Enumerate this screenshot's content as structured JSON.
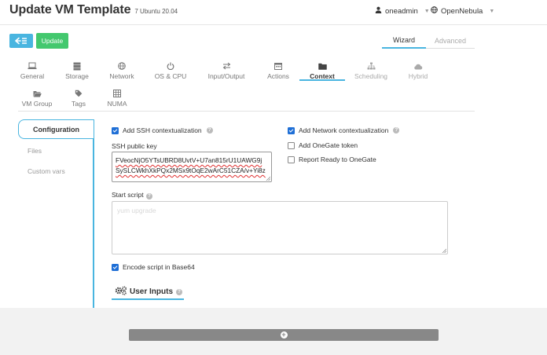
{
  "header": {
    "title": "Update VM Template",
    "subtitle": "7 Ubuntu 20.04",
    "user": "oneadmin",
    "zone": "OpenNebula"
  },
  "toolbar": {
    "update_label": "Update",
    "wizard_label": "Wizard",
    "advanced_label": "Advanced"
  },
  "section_tabs": [
    {
      "label": "General",
      "icon": "laptop-icon"
    },
    {
      "label": "Storage",
      "icon": "database-icon"
    },
    {
      "label": "Network",
      "icon": "globe-icon"
    },
    {
      "label": "OS & CPU",
      "icon": "power-icon"
    },
    {
      "label": "Input/Output",
      "icon": "exchange-icon"
    },
    {
      "label": "Actions",
      "icon": "calendar-icon"
    },
    {
      "label": "Context",
      "icon": "folder-icon"
    },
    {
      "label": "Scheduling",
      "icon": "sitemap-icon"
    },
    {
      "label": "Hybrid",
      "icon": "cloud-icon"
    },
    {
      "label": "VM Group",
      "icon": "folder-open-icon"
    },
    {
      "label": "Tags",
      "icon": "tag-icon"
    },
    {
      "label": "NUMA",
      "icon": "grid-icon"
    }
  ],
  "active_tab": "Context",
  "sub_tabs": {
    "configuration": "Configuration",
    "files": "Files",
    "custom_vars": "Custom vars"
  },
  "form": {
    "add_ssh_label": "Add SSH contextualization",
    "add_ssh_checked": true,
    "ssh_key_label": "SSH public key",
    "ssh_key_lines": [
      "FVeocNjO5YTsUBRD8UvtV+U7an815rU1UAWG9j",
      "SySLCWkhXkPQx2MSx9tOqE2wArC51CZA/v+Yi8z"
    ],
    "start_script_label": "Start script",
    "start_script_placeholder": "yum upgrade",
    "encode_label": "Encode script in Base64",
    "encode_checked": true,
    "add_network_label": "Add Network contextualization",
    "add_network_checked": true,
    "add_onegate_label": "Add OneGate token",
    "add_onegate_checked": false,
    "report_ready_label": "Report Ready to OneGate",
    "report_ready_checked": false,
    "user_inputs_title": "User Inputs"
  },
  "colors": {
    "accent": "#49b5e0",
    "update_green": "#43c86e",
    "checkbox_blue": "#1f6fd6"
  }
}
